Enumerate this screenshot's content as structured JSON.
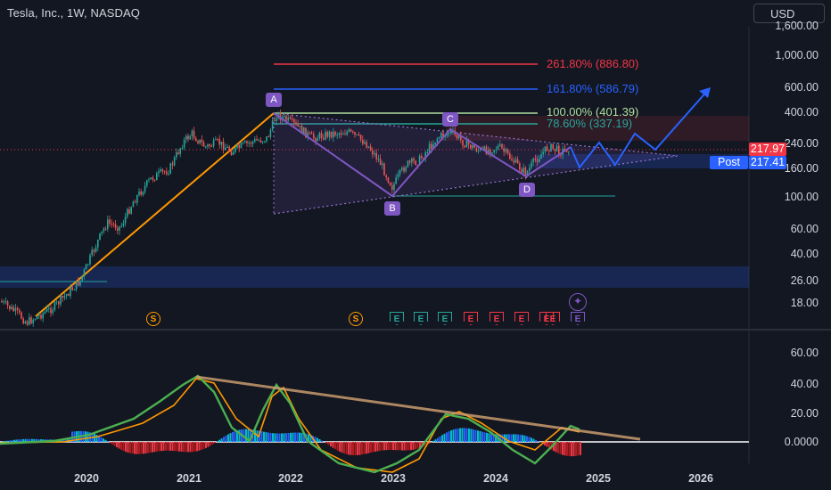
{
  "header": {
    "title": "Tesla, Inc., 1W, NASDAQ",
    "currency": "USD"
  },
  "price_axis": {
    "labels": [
      "1,600.00",
      "1,000.00",
      "600.00",
      "400.00",
      "240.00",
      "160.00",
      "100.00",
      "60.00",
      "40.00",
      "26.00",
      "18.00"
    ]
  },
  "price_badges": {
    "last_price": "217.97",
    "post_label": "Post",
    "post_price": "217.41",
    "last_color": "#f23645",
    "post_color": "#2962ff"
  },
  "indicator_axis": {
    "labels": [
      "60.00",
      "40.00",
      "20.00",
      "0.0000"
    ]
  },
  "time_axis": {
    "labels": [
      "2020",
      "2021",
      "2022",
      "2023",
      "2024",
      "2025",
      "2026"
    ]
  },
  "fibonacci": {
    "fib_2618": "261.80% (886.80)",
    "fib_1618": "161.80% (586.79)",
    "fib_100": "100.00% (401.39)",
    "fib_786": "78.60% (337.19)",
    "colors": {
      "fib_2618": "#f23645",
      "fib_1618": "#2962ff",
      "fib_100": "#b2dfa0",
      "fib_786": "#26a69a"
    }
  },
  "pattern_points": [
    "A",
    "B",
    "C",
    "D"
  ],
  "events": {
    "splits": [
      "S",
      "S"
    ],
    "earnings": [
      "E",
      "E",
      "E",
      "E",
      "E",
      "E",
      "E",
      "E",
      "E"
    ],
    "earnings_colors": [
      "#26a69a",
      "#26a69a",
      "#26a69a",
      "#f23645",
      "#f23645",
      "#f23645",
      "#f23645",
      "#f23645",
      "#7e57c2"
    ],
    "split_color": "#ff9800"
  },
  "colors": {
    "background": "#131722",
    "up_candle": "#26a69a",
    "down_candle": "#ef5350",
    "pattern": "#7e57c2",
    "trend": "#ff9800",
    "projection": "#2962ff"
  }
}
